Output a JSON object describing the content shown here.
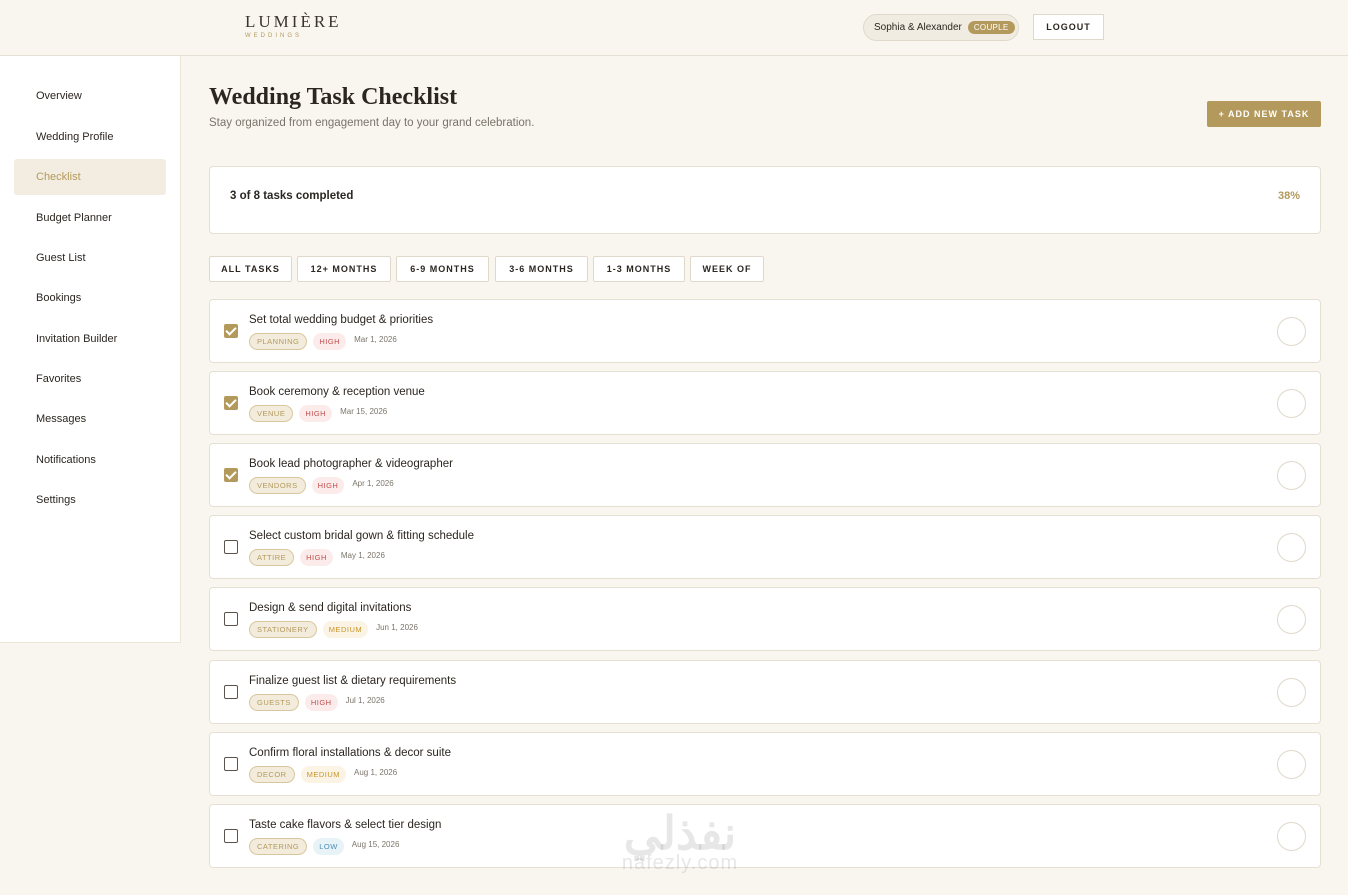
{
  "header": {
    "logo_name": "LUMIÈRE",
    "logo_sub": "WEDDINGS",
    "user_name": "Sophia & Alexander",
    "user_badge": "COUPLE",
    "logout_label": "LOGOUT"
  },
  "sidebar": {
    "items": [
      {
        "label": "Overview"
      },
      {
        "label": "Wedding Profile"
      },
      {
        "label": "Checklist",
        "active": true
      },
      {
        "label": "Budget Planner"
      },
      {
        "label": "Guest List"
      },
      {
        "label": "Bookings"
      },
      {
        "label": "Invitation Builder"
      },
      {
        "label": "Favorites"
      },
      {
        "label": "Messages"
      },
      {
        "label": "Notifications"
      },
      {
        "label": "Settings"
      }
    ]
  },
  "main": {
    "title": "Wedding Task Checklist",
    "subtitle": "Stay organized from engagement day to your grand celebration.",
    "add_button": "+ ADD NEW TASK",
    "progress": {
      "text": "3 of 8 tasks completed",
      "percent_label": "38%",
      "completed": 3,
      "total": 8
    },
    "filters": [
      "ALL TASKS",
      "12+ MONTHS",
      "6-9 MONTHS",
      "3-6 MONTHS",
      "1-3 MONTHS",
      "WEEK OF"
    ],
    "tasks": [
      {
        "title": "Set total wedding budget & priorities",
        "category": "PLANNING",
        "priority": "HIGH",
        "date": "Mar 1, 2026",
        "done": true
      },
      {
        "title": "Book ceremony & reception venue",
        "category": "VENUE",
        "priority": "HIGH",
        "date": "Mar 15, 2026",
        "done": true
      },
      {
        "title": "Book lead photographer & videographer",
        "category": "VENDORS",
        "priority": "HIGH",
        "date": "Apr 1, 2026",
        "done": true
      },
      {
        "title": "Select custom bridal gown & fitting schedule",
        "category": "ATTIRE",
        "priority": "HIGH",
        "date": "May 1, 2026",
        "done": false
      },
      {
        "title": "Design & send digital invitations",
        "category": "STATIONERY",
        "priority": "MEDIUM",
        "date": "Jun 1, 2026",
        "done": false
      },
      {
        "title": "Finalize guest list & dietary requirements",
        "category": "GUESTS",
        "priority": "HIGH",
        "date": "Jul 1, 2026",
        "done": false
      },
      {
        "title": "Confirm floral installations & decor suite",
        "category": "DECOR",
        "priority": "MEDIUM",
        "date": "Aug 1, 2026",
        "done": false
      },
      {
        "title": "Taste cake flavors & select tier design",
        "category": "CATERING",
        "priority": "LOW",
        "date": "Aug 15, 2026",
        "done": false
      }
    ]
  },
  "watermark": {
    "arabic": "نفذلي",
    "latin": "nafezly.com"
  },
  "colors": {
    "accent": "#b39a5c",
    "background": "#f9f6f0",
    "high": "#c0504d",
    "medium": "#c8952f",
    "low": "#4a8db5"
  }
}
